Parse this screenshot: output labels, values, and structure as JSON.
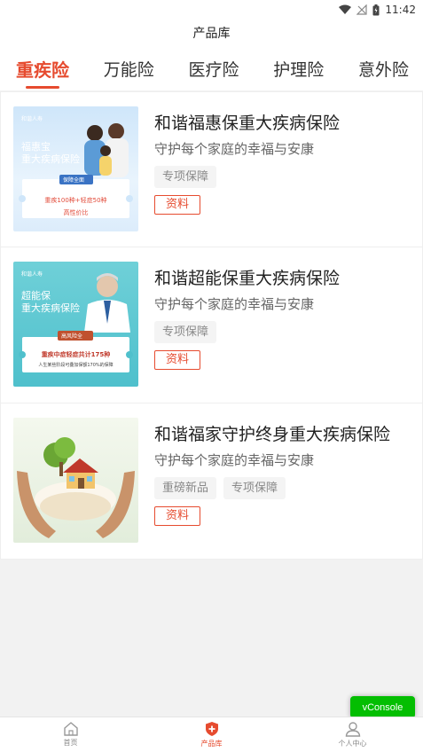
{
  "status_bar": {
    "time": "11:42"
  },
  "header": {
    "title": "产品库"
  },
  "tabs": [
    {
      "label": "重疾险",
      "active": true
    },
    {
      "label": "万能险",
      "active": false
    },
    {
      "label": "医疗险",
      "active": false
    },
    {
      "label": "护理险",
      "active": false
    },
    {
      "label": "意外险",
      "active": false
    }
  ],
  "products": [
    {
      "title": "和谐福惠保重大疾病保险",
      "subtitle": "守护每个家庭的幸福与安康",
      "tags": [
        "专项保障"
      ],
      "info_label": "资料",
      "thumb": {
        "logo": "和谐人寿",
        "name_line1": "福惠宝",
        "name_line2": "重大疾病保险",
        "ribbon": "保障全面",
        "line1": "重疾100种+轻症50种",
        "line2": "高性价比"
      }
    },
    {
      "title": "和谐超能保重大疾病保险",
      "subtitle": "守护每个家庭的幸福与安康",
      "tags": [
        "专项保障"
      ],
      "info_label": "资料",
      "thumb": {
        "logo": "和谐人寿",
        "name_line1": "超能保",
        "name_line2": "重大疾病保险",
        "ribbon": "高风险全",
        "line1": "重疾中症轻症共计175种",
        "line2": "人生某些阶段可叠加保额170%的保障"
      }
    },
    {
      "title": "和谐福家守护终身重大疾病保险",
      "subtitle": "守护每个家庭的幸福与安康",
      "tags": [
        "重磅新品",
        "专项保障"
      ],
      "info_label": "资料",
      "thumb": {}
    }
  ],
  "bottom_nav": [
    {
      "label": "首页",
      "icon": "home-icon",
      "active": false
    },
    {
      "label": "产品库",
      "icon": "shield-plus-icon",
      "active": true
    },
    {
      "label": "个人中心",
      "icon": "user-icon",
      "active": false
    }
  ],
  "vconsole": {
    "label": "vConsole"
  },
  "colors": {
    "accent": "#e64b2f",
    "vconsole": "#04be02"
  }
}
